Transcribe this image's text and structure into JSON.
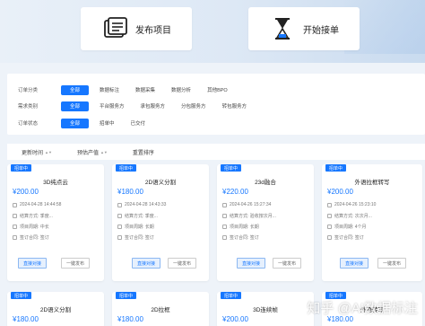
{
  "header": {
    "publish_label": "发布项目",
    "start_label": "开始接单"
  },
  "filters": {
    "order_category": {
      "label": "订单分类",
      "options": [
        "全部",
        "数据标注",
        "数据采集",
        "数据分析",
        "其他BPO"
      ]
    },
    "demand_category": {
      "label": "需求类别",
      "options": [
        "全部",
        "平台服务方",
        "承包服务方",
        "分包服务方",
        "转包服务方"
      ]
    },
    "order_status": {
      "label": "订单状态",
      "options": [
        "全部",
        "招单中",
        "已交付"
      ]
    }
  },
  "sort": {
    "update_time": "更新时间",
    "budget": "预估产值",
    "reorder": "重置排序"
  },
  "cards": [
    {
      "badge": "招单中",
      "title": "3D纯点云",
      "price": "¥200.00",
      "date": "2024-04-28 14:44:58",
      "settle": "结算方式: 季度...",
      "period": "项目周期: 中长",
      "contract": "签订合同: 签订",
      "btn1": "直接对接",
      "btn2": "一键发布"
    },
    {
      "badge": "招单中",
      "title": "2D语义分割",
      "price": "¥180.00",
      "date": "2024-04-28 14:43:33",
      "settle": "结算方式: 季度...",
      "period": "项目周期: 长期",
      "contract": "签订合同: 签订",
      "btn1": "直接对接",
      "btn2": "一键发布"
    },
    {
      "badge": "招单中",
      "title": "23d融合",
      "price": "¥220.00",
      "date": "2024-04-26 15:27:34",
      "settle": "结算方式: 验收按次月...",
      "period": "项目周期: 长期",
      "contract": "签订合同: 签订",
      "btn1": "直接对接",
      "btn2": "一键发布"
    },
    {
      "badge": "招单中",
      "title": "外语拉框转写",
      "price": "¥200.00",
      "date": "2024-04-26 15:23:10",
      "settle": "结算方式: 次次月...",
      "period": "项目周期: 4个月",
      "contract": "签订合同: 签订",
      "btn1": "直接对接",
      "btn2": "一键发布"
    },
    {
      "badge": "招单中",
      "title": "2D语义分割",
      "price": "¥180.00"
    },
    {
      "badge": "招单中",
      "title": "2D拉框",
      "price": "¥180.00"
    },
    {
      "badge": "招单中",
      "title": "3D连续帧",
      "price": "¥200.00"
    },
    {
      "badge": "招单中",
      "title": "外语转写",
      "price": "¥180.00"
    }
  ],
  "watermark": "知乎 @AI数据标注",
  "colors": {
    "accent": "#1677ff",
    "background": "#eef3f9"
  }
}
